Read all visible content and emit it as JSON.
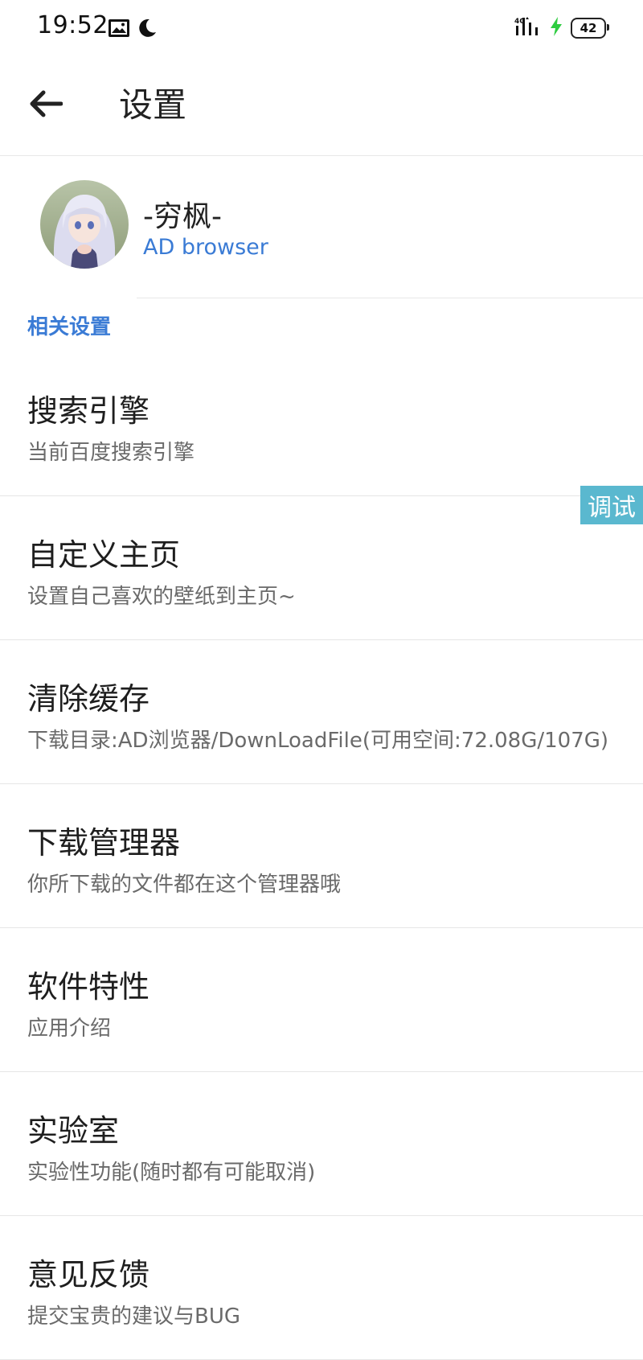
{
  "status_bar": {
    "time": "19:52",
    "network": "4G",
    "battery": "42"
  },
  "app_bar": {
    "title": "设置"
  },
  "profile": {
    "name": "-穷枫-",
    "subtitle": "AD browser"
  },
  "section": {
    "header": "相关设置"
  },
  "settings": [
    {
      "title": "搜索引擎",
      "subtitle": "当前百度搜索引擎"
    },
    {
      "title": "自定义主页",
      "subtitle": "设置自己喜欢的壁纸到主页~"
    },
    {
      "title": "清除缓存",
      "subtitle": "下载目录:AD浏览器/DownLoadFile(可用空间:72.08G/107G)"
    },
    {
      "title": "下载管理器",
      "subtitle": "你所下载的文件都在这个管理器哦"
    },
    {
      "title": "软件特性",
      "subtitle": "应用介绍"
    },
    {
      "title": "实验室",
      "subtitle": "实验性功能(随时都有可能取消)"
    },
    {
      "title": "意见反馈",
      "subtitle": "提交宝贵的建议与BUG"
    }
  ],
  "debug": {
    "label": "调试"
  },
  "colors": {
    "accent": "#3a7bd5",
    "debug_bg": "#5ab8cf",
    "charging": "#2ecc40"
  }
}
